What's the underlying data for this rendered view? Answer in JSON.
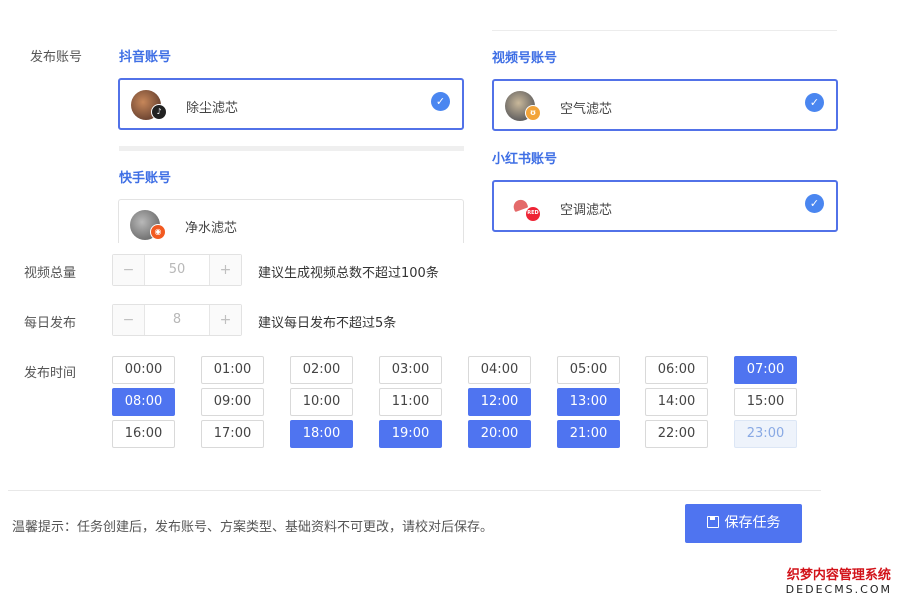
{
  "publish_accounts": {
    "label": "发布账号",
    "platforms": [
      {
        "title": "抖音账号",
        "account": "除尘滤芯",
        "selected": true,
        "badge_icon": "tiktok-icon",
        "badge_color": "#222222",
        "avatar_color": "#7a4d3a"
      },
      {
        "title": "视频号账号",
        "account": "空气滤芯",
        "selected": true,
        "badge_icon": "wechat-channels-icon",
        "badge_color": "#f2a43a",
        "avatar_color": "#5a6070"
      },
      {
        "title": "快手账号",
        "account": "净水滤芯",
        "selected": false,
        "badge_icon": "kuaishou-icon",
        "badge_color": "#f25a21",
        "avatar_color": "#8a8a8a"
      },
      {
        "title": "小红书账号",
        "account": "空调滤芯",
        "selected": true,
        "badge_icon": "xiaohongshu-icon",
        "badge_color": "#ee2435",
        "avatar_color": "#e05a5a"
      }
    ]
  },
  "video_total": {
    "label": "视频总量",
    "value": "50",
    "minus": "−",
    "plus": "+",
    "hint": "建议生成视频总数不超过100条"
  },
  "daily_publish": {
    "label": "每日发布",
    "value": "8",
    "minus": "−",
    "plus": "+",
    "hint": "建议每日发布不超过5条"
  },
  "publish_time": {
    "label": "发布时间",
    "slots": [
      {
        "time": "00:00",
        "state": "off"
      },
      {
        "time": "01:00",
        "state": "off"
      },
      {
        "time": "02:00",
        "state": "off"
      },
      {
        "time": "03:00",
        "state": "off"
      },
      {
        "time": "04:00",
        "state": "off"
      },
      {
        "time": "05:00",
        "state": "off"
      },
      {
        "time": "06:00",
        "state": "off"
      },
      {
        "time": "07:00",
        "state": "on"
      },
      {
        "time": "08:00",
        "state": "on"
      },
      {
        "time": "09:00",
        "state": "off"
      },
      {
        "time": "10:00",
        "state": "off"
      },
      {
        "time": "11:00",
        "state": "off"
      },
      {
        "time": "12:00",
        "state": "on"
      },
      {
        "time": "13:00",
        "state": "on"
      },
      {
        "time": "14:00",
        "state": "off"
      },
      {
        "time": "15:00",
        "state": "off"
      },
      {
        "time": "16:00",
        "state": "off"
      },
      {
        "time": "17:00",
        "state": "off"
      },
      {
        "time": "18:00",
        "state": "on"
      },
      {
        "time": "19:00",
        "state": "on"
      },
      {
        "time": "20:00",
        "state": "on"
      },
      {
        "time": "21:00",
        "state": "on"
      },
      {
        "time": "22:00",
        "state": "off"
      },
      {
        "time": "23:00",
        "state": "disabled"
      }
    ]
  },
  "footer": {
    "tip": "温馨提示：任务创建后，发布账号、方案类型、基础资料不可更改，请校对后保存。",
    "save_label": "保存任务",
    "save_icon": "save-icon"
  },
  "watermark": {
    "line1": "织梦内容管理系统",
    "line2": "DEDECMS.COM"
  },
  "colors": {
    "accent": "#4f74f0",
    "title_blue": "#3f6fe5",
    "check_blue": "#4a86f0"
  }
}
